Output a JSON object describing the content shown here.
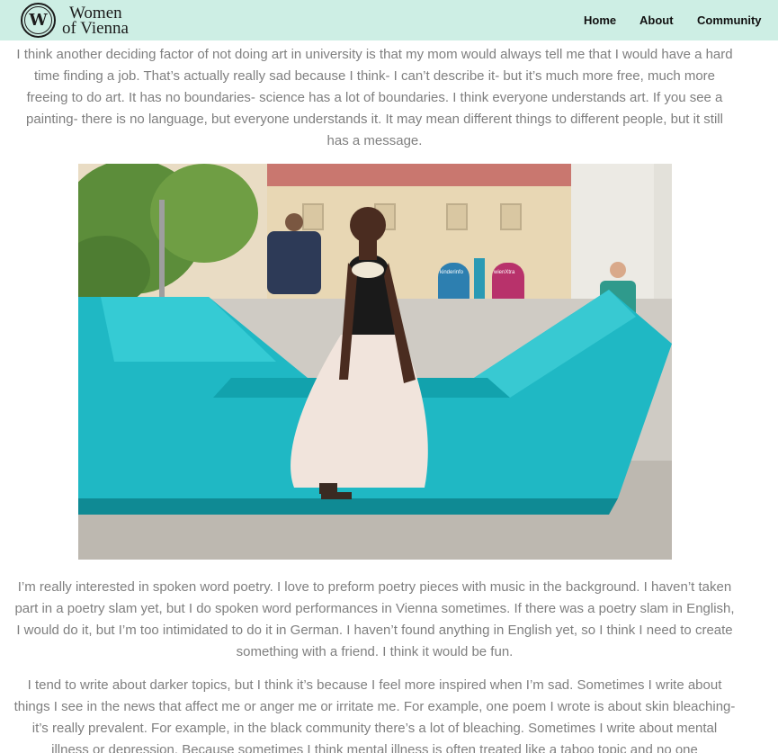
{
  "header": {
    "logo_mark": "W",
    "logo_line1": "Women",
    "logo_line2": "of Vienna",
    "nav": {
      "home": "Home",
      "about": "About",
      "community": "Community"
    }
  },
  "article": {
    "paragraph1": "I think another deciding factor of not doing art in university is that my mom would always tell me that I would have a hard time finding a job. That’s actually really sad because I think- I can’t describe it- but it’s much more free, much more freeing to do art. It has no boundaries- science has a lot of boundaries. I think everyone understands art. If you see a painting- there is no language, but everyone understands it. It may mean different things to different people, but it still has a message.",
    "photo": {
      "sign_kinderinfo": "kinderinfo",
      "sign_wienxtra": "wienXtra"
    },
    "paragraph2": "I’m really interested in spoken word poetry. I love to preform poetry pieces with music in the background. I haven’t taken part in a poetry slam yet, but I do spoken word performances in Vienna sometimes. If there was a poetry slam in English, I would do it, but I’m too intimidated to do it in German. I haven’t found anything in English yet, so I think I need to create something with a friend. I think it would be fun.",
    "paragraph3": "I tend to write about darker topics, but I think it’s because I feel more inspired when I’m sad. Sometimes I write about things I see in the news that affect me or anger me or irritate me. For example, one poem I wrote is about skin bleaching- it’s really prevalent. For example, in the black community there’s a lot of bleaching. Sometimes I write about mental illness or depression. Because sometimes I think mental illness is often treated like a taboo topic and no one"
  },
  "colors": {
    "header_bg": "#cdeee4",
    "body_text": "#7f7f7f",
    "bench": "#1fb8c4"
  }
}
